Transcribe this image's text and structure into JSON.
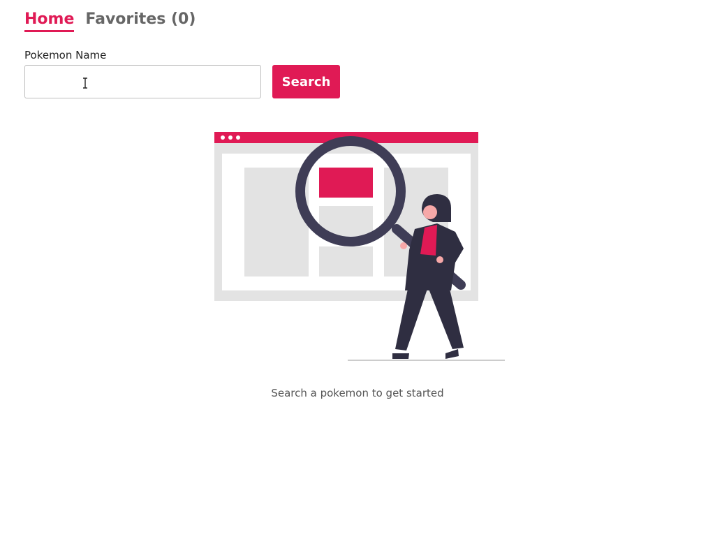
{
  "nav": {
    "tabs": [
      {
        "label": "Home",
        "active": true
      },
      {
        "label": "Favorites (0)",
        "active": false
      }
    ]
  },
  "search": {
    "label": "Pokemon Name",
    "value": "",
    "button_label": "Search"
  },
  "empty_state": {
    "message": "Search a pokemon to get started",
    "illustration_icon": "magnifier-search-illustration"
  },
  "colors": {
    "accent": "#e01a55",
    "inactive_tab": "#666666",
    "placeholder_gray": "#e3e3e3",
    "figure_dark": "#2f2e41"
  }
}
